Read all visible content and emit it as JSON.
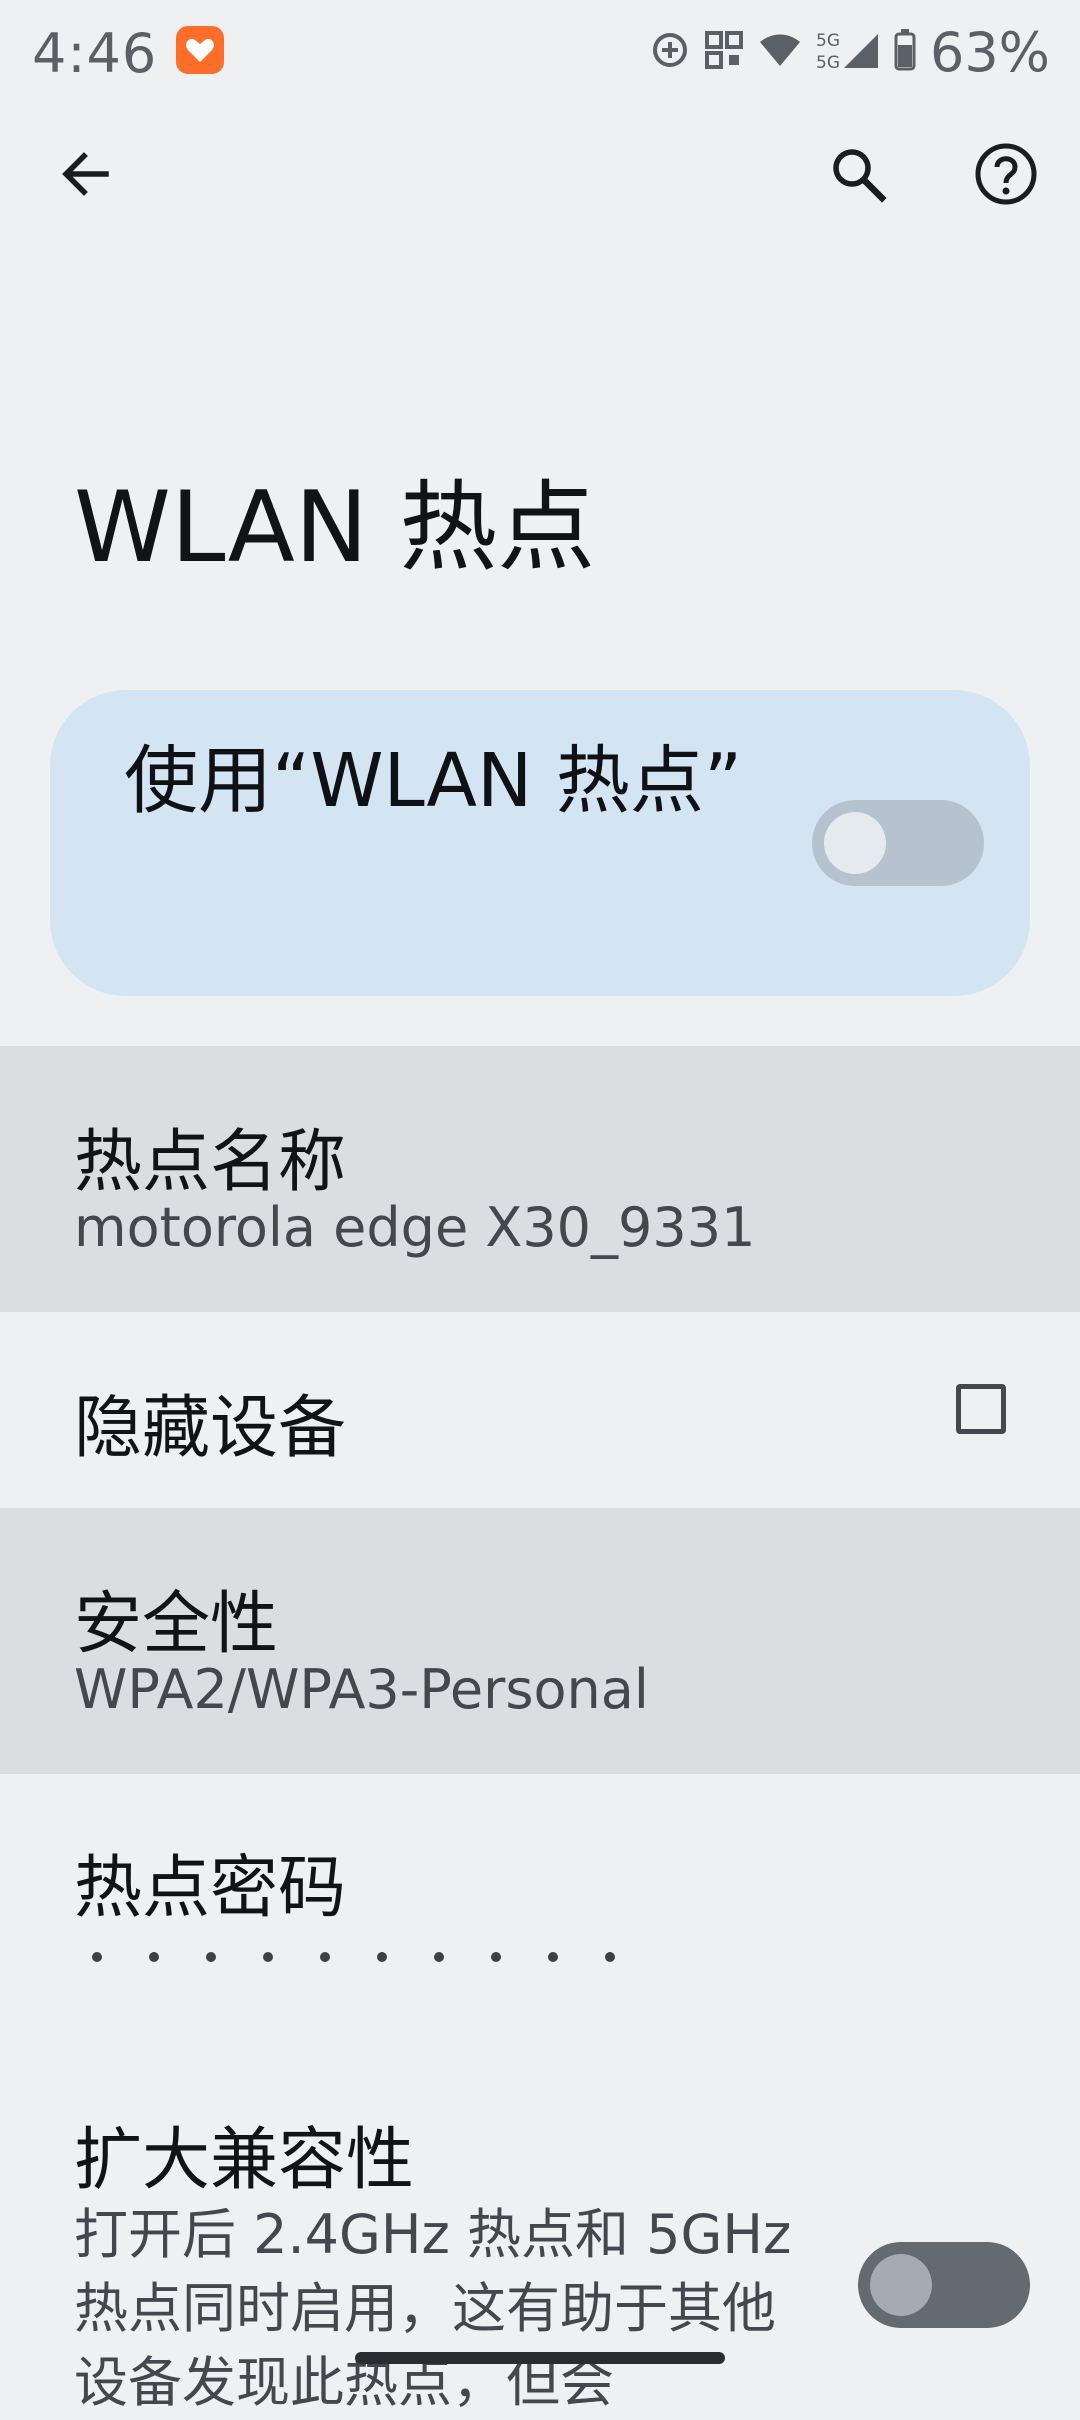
{
  "status_bar": {
    "time": "4:46",
    "battery": "63%",
    "network": "5G 5G"
  },
  "header": {
    "title": "WLAN 热点",
    "back_icon": "arrow-left-icon",
    "search_icon": "search-icon",
    "help_icon": "help-circle-icon"
  },
  "main_toggle": {
    "label": "使用“WLAN 热点”",
    "state": "off"
  },
  "settings": {
    "hotspot_name": {
      "title": "热点名称",
      "value": "motorola edge X30_9331"
    },
    "hide_device": {
      "title": "隐藏设备",
      "checked": false
    },
    "security": {
      "title": "安全性",
      "value": "WPA2/WPA3-Personal"
    },
    "password": {
      "title": "热点密码",
      "dot_count": 10
    },
    "extend_compat": {
      "title": "扩大兼容性",
      "description": "打开后 2.4GHz 热点和 5GHz 热点同时启用，这有助于其他设备发现此热点，但会",
      "state": "off"
    }
  },
  "colors": {
    "background": "#eff0f2",
    "card": "#d3e4f3",
    "highlight_row": "#dcdde0",
    "switch_track_main": "#b6c3cf",
    "switch_track_compat": "#636a70",
    "app_icon": "#ff6d2b"
  }
}
